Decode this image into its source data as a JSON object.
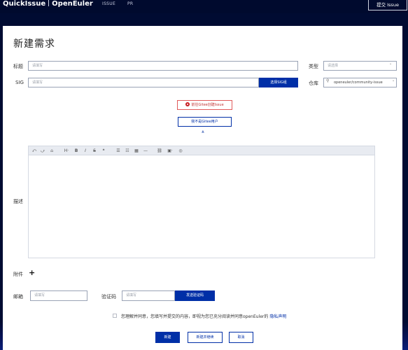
{
  "header": {
    "brand_quickissue": "QuickIssue",
    "brand_openeuler": "OpenEuler",
    "nav": [
      {
        "label": "ISSUE"
      },
      {
        "label": "PR"
      }
    ],
    "submit_issue": "提交 Issue"
  },
  "form": {
    "title": "新建需求",
    "title_label": "标题",
    "title_placeholder": "请填写",
    "type_label": "类型",
    "type_placeholder": "请选择",
    "sig_label": "SIG",
    "sig_placeholder": "请填写",
    "select_sig": "选择SIG组",
    "repo_label": "仓库",
    "repo_value": "openeuler/community-issue",
    "gitee_button": "前往Gitee创建Issue",
    "not_gitee_user": "我不是Gitee用户",
    "description_label": "描述",
    "attachment_label": "附件",
    "email_label": "邮箱",
    "email_placeholder": "请填写",
    "code_label": "验证码",
    "code_placeholder": "请填写",
    "send_code": "发送验证码",
    "agree_text": "您理解并同意，您填写并提交的内容，即视为您已充分阅读并同意openEuler的",
    "privacy_link": "隐私声明",
    "create_button": "新建",
    "create_continue_button": "新建并继续",
    "cancel_button": "取消"
  },
  "editor_toolbar": {
    "undo": "⤺",
    "redo": "⤻",
    "clear": "⌂",
    "heading": "H·",
    "bold": "B",
    "italic": "I",
    "strike": "S",
    "quote": "❝",
    "ul": "☰",
    "ol": "☷",
    "table": "▦",
    "hr": "—",
    "link": "⛓",
    "image": "▣·",
    "preview": "◎"
  },
  "icons": {
    "chevron": "⌄",
    "chevron_up": "▲",
    "search": "⚲",
    "plus": "+"
  },
  "colors": {
    "primary": "#002fa7",
    "background": "#000b32",
    "gitee_red": "#c71d23"
  }
}
